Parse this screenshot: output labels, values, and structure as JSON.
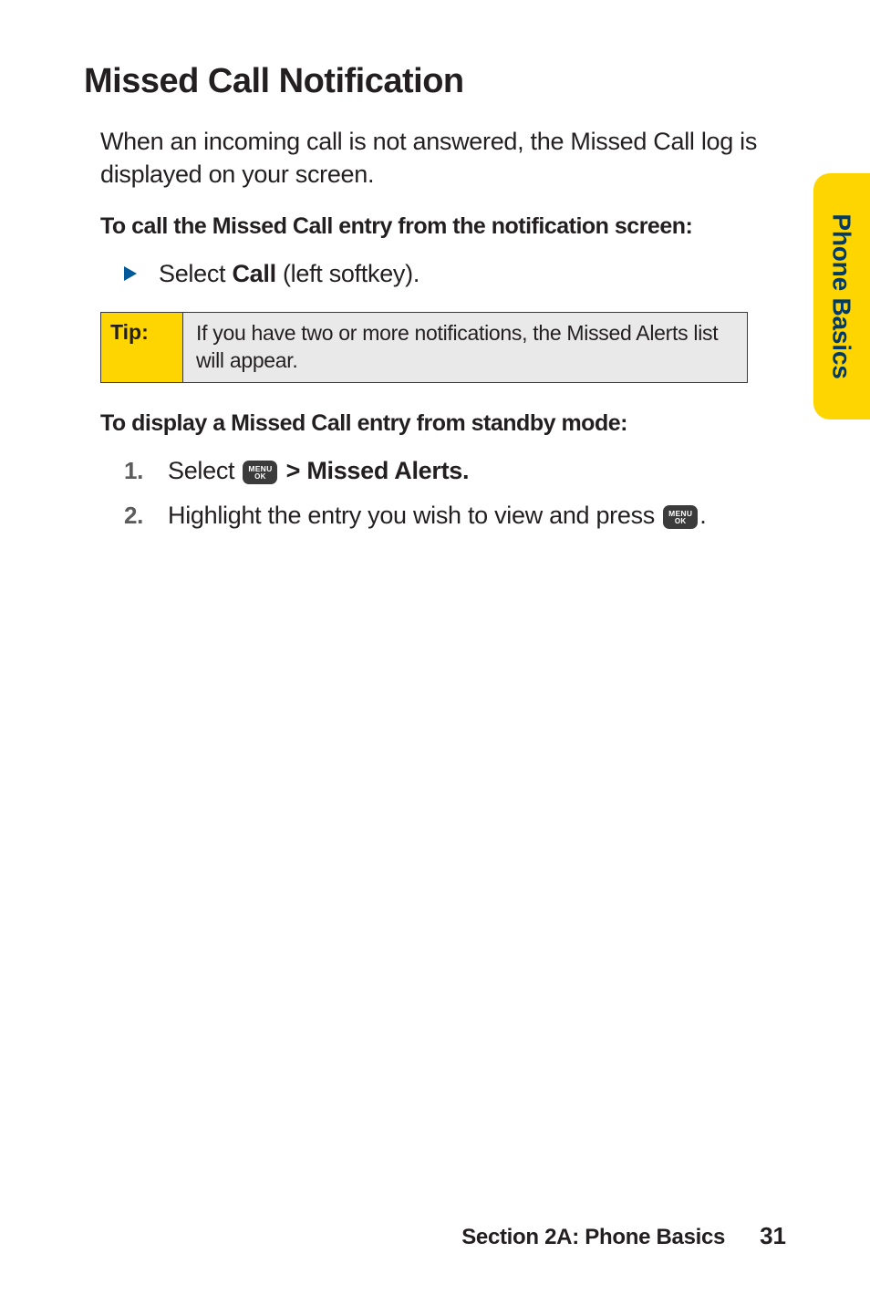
{
  "side_tab": {
    "label": "Phone Basics"
  },
  "title": "Missed Call Notification",
  "intro": "When an incoming call is not answered, the Missed Call log is displayed on your screen.",
  "instruction1": {
    "heading": "To call the Missed Call entry from the notification screen:",
    "bullet_prefix": "Select ",
    "bullet_bold": "Call",
    "bullet_suffix": " (left softkey)."
  },
  "tip": {
    "label": "Tip:",
    "body": "If you have two or more notifications, the Missed Alerts list will appear."
  },
  "instruction2": {
    "heading": "To display a Missed Call entry from standby mode:",
    "step1_num": "1.",
    "step1_prefix": "Select ",
    "step1_bold": " > Missed Alerts.",
    "step2_num": "2.",
    "step2_prefix": "Highlight the entry you wish to view and press ",
    "step2_suffix": "."
  },
  "menu_key": {
    "line1": "MENU",
    "line2": "OK"
  },
  "footer": {
    "section": "Section 2A: Phone Basics",
    "page": "31"
  }
}
